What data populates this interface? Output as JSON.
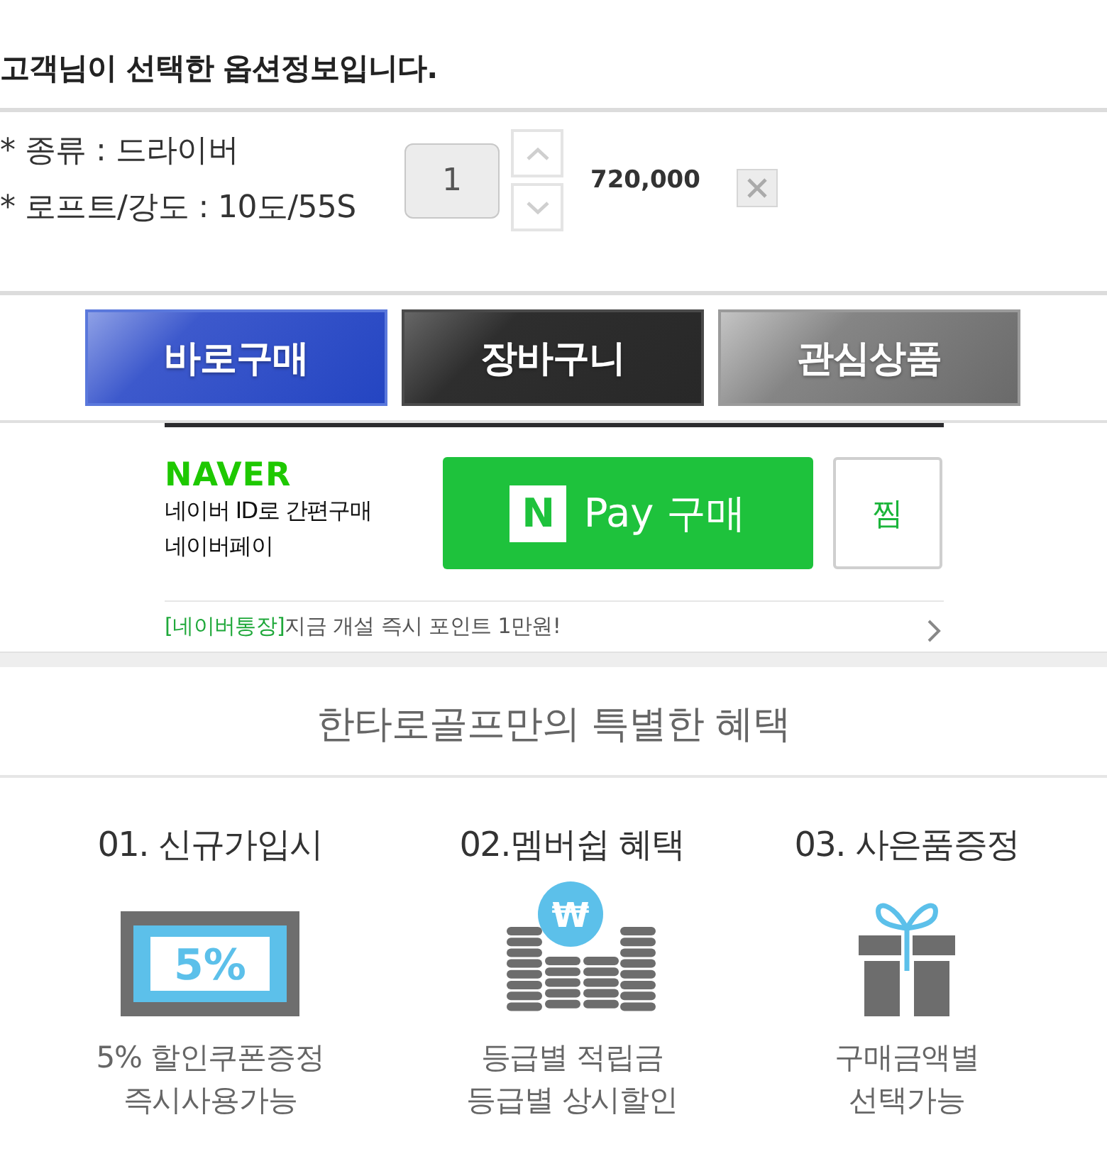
{
  "heading": "고객님이 선택한 옵션정보입니다.",
  "option": {
    "lines": [
      "* 종류 : 드라이버",
      "* 로프트/강도 : 10도/55S"
    ],
    "quantity": "1",
    "price": "720,000"
  },
  "actions": [
    {
      "label": "바로구매",
      "kind": "buy"
    },
    {
      "label": "장바구니",
      "kind": "cart"
    },
    {
      "label": "관심상품",
      "kind": "wish"
    }
  ],
  "naver_pay": {
    "logo": "NAVER",
    "lines": [
      "네이버 ID로 간편구매",
      "네이버페이"
    ],
    "pay_button": {
      "badge": "N",
      "label": "Pay 구매"
    },
    "wish_button": "찜",
    "promo": {
      "tag": "[네이버통장]",
      "text": "지금 개설 즉시 포인트 1만원!"
    }
  },
  "benefits": {
    "title": "한타로골프만의 특별한 혜택",
    "items": [
      {
        "kind": "coupon",
        "title": "01. 신규가입시",
        "icon_text": "5%",
        "lines": [
          "5% 할인쿠폰증정",
          "즉시사용가능"
        ]
      },
      {
        "kind": "coins",
        "title": "02.멤버쉽 혜택",
        "icon_text": "₩",
        "lines": [
          "등급별 적립금",
          "등급별 상시할인"
        ]
      },
      {
        "kind": "gift",
        "title": "03. 사은품증정",
        "lines": [
          "구매금액별",
          "선택가능"
        ]
      }
    ]
  }
}
